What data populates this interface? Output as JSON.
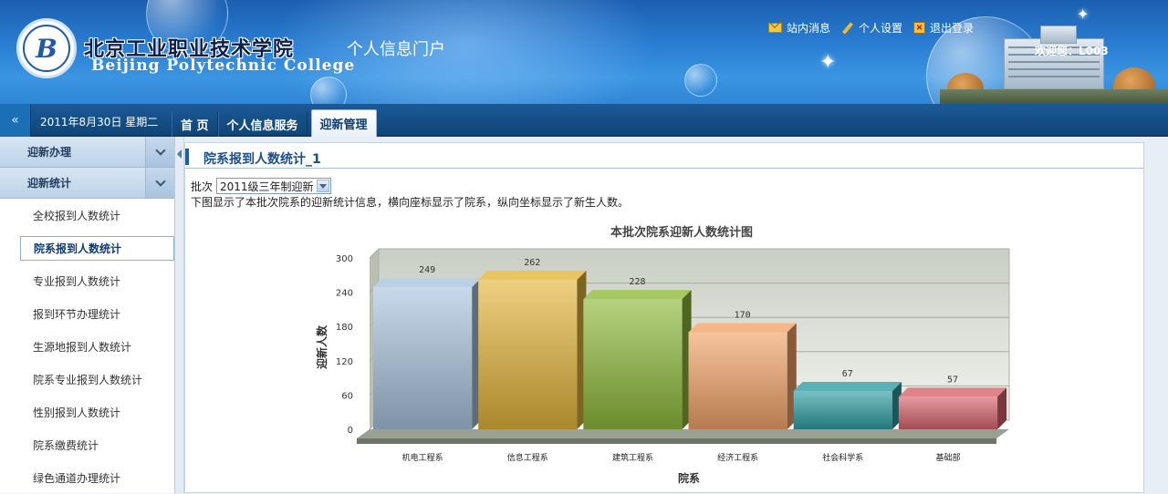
{
  "header": {
    "school_cn": "北京工业职业技术学院",
    "portal": "个人信息门户",
    "school_en": "Beijing Polytechnic College",
    "links": [
      "站内消息",
      "个人设置",
      "退出登录"
    ],
    "welcome": "欢迎您：L003"
  },
  "nav": {
    "date": "2011年8月30日 星期二",
    "tabs": [
      "首 页",
      "个人信息服务",
      "迎新管理"
    ],
    "active_tab": "迎新管理"
  },
  "sidebar": {
    "groups": [
      "迎新办理",
      "迎新统计"
    ],
    "items": [
      "全校报到人数统计",
      "院系报到人数统计",
      "专业报到人数统计",
      "报到环节办理统计",
      "生源地报到人数统计",
      "院系专业报到人数统计",
      "性别报到人数统计",
      "院系缴费统计",
      "绿色通道办理统计"
    ],
    "active_item": "院系报到人数统计"
  },
  "main": {
    "title": "院系报到人数统计_1",
    "batch_label": "批次",
    "batch_value": "2011级三年制迎新",
    "description": "下图显示了本批次院系的迎新统计信息，横向座标显示了院系，纵向坐标显示了新生人数。"
  },
  "chart_data": {
    "type": "bar",
    "title": "本批次院系迎新人数统计图",
    "xlabel": "院系",
    "ylabel": "迎新人数",
    "categories": [
      "机电工程系",
      "信息工程系",
      "建筑工程系",
      "经济工程系",
      "社会科学系",
      "基础部"
    ],
    "values": [
      249,
      262,
      228,
      170,
      67,
      57
    ],
    "ylim": [
      0,
      300
    ],
    "yticks": [
      0,
      60,
      120,
      180,
      240,
      300
    ],
    "colors": [
      "#a9c4df",
      "#e3b53a",
      "#8fba3a",
      "#f3a46a",
      "#2f9ea3",
      "#d9646e"
    ],
    "grid": true
  }
}
